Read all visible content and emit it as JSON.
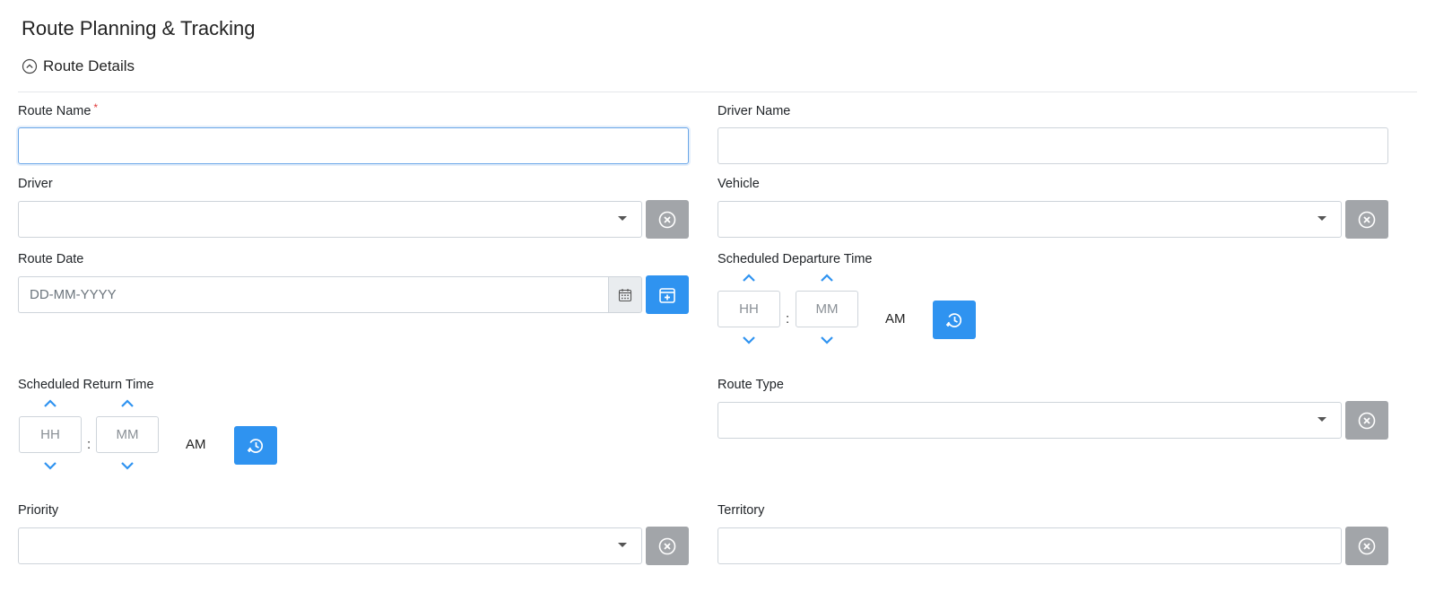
{
  "page": {
    "title": "Route Planning & Tracking"
  },
  "section": {
    "title": "Route Details"
  },
  "fields": {
    "route_name": {
      "label": "Route Name",
      "required_mark": "*",
      "value": ""
    },
    "driver_name": {
      "label": "Driver Name",
      "value": ""
    },
    "driver": {
      "label": "Driver",
      "selected": ""
    },
    "vehicle": {
      "label": "Vehicle",
      "selected": ""
    },
    "route_date": {
      "label": "Route Date",
      "placeholder": "DD-MM-YYYY"
    },
    "departure": {
      "label": "Scheduled Departure Time",
      "hh_placeholder": "HH",
      "mm_placeholder": "MM",
      "separator": ":",
      "meridian": "AM"
    },
    "return": {
      "label": "Scheduled Return Time",
      "hh_placeholder": "HH",
      "mm_placeholder": "MM",
      "separator": ":",
      "meridian": "AM"
    },
    "route_type": {
      "label": "Route Type",
      "selected": ""
    },
    "priority": {
      "label": "Priority",
      "selected": ""
    },
    "territory": {
      "label": "Territory",
      "value": ""
    }
  },
  "icons": {
    "collapse": "chevron-up-circle-icon",
    "clear": "close-circle-icon",
    "calendar": "calendar-icon",
    "calendar_add": "calendar-plus-icon",
    "time_add": "clock-history-icon",
    "chevron_up": "chevron-up-icon",
    "chevron_down": "chevron-down-icon"
  },
  "colors": {
    "primary": "#2f93f0",
    "clear_button": "#a2a5a9",
    "required": "#e03a3a",
    "focus_border": "#6aa6e8"
  }
}
